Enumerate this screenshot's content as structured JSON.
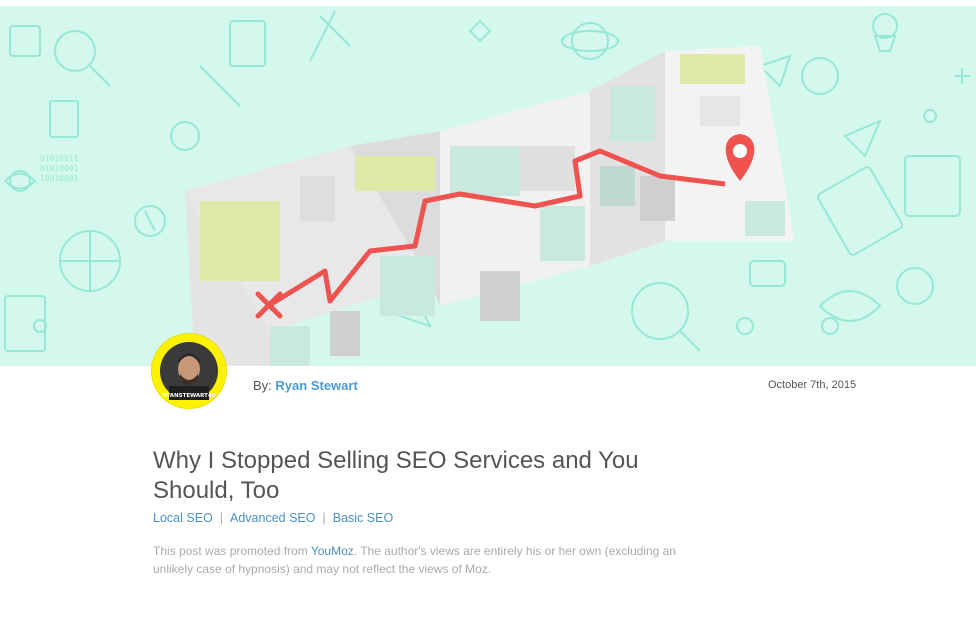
{
  "hero": {
    "icon": "map-route-illustration"
  },
  "author": {
    "avatar_caption": "RYANSTEWART40",
    "by_label": "By:",
    "name": "Ryan Stewart"
  },
  "post": {
    "date": "October 7th, 2015",
    "title": "Why I Stopped Selling SEO Services and You Should, Too",
    "categories": [
      "Local SEO",
      "Advanced SEO",
      "Basic SEO"
    ],
    "separator": "|",
    "promo_prefix": "This post was promoted from ",
    "promo_link": "YouMoz",
    "promo_suffix": ". The author's views are entirely his or her own (excluding an unlikely case of hypnosis) and may not reflect the views of Moz."
  },
  "colors": {
    "hero_bg": "#d5f8ee",
    "route": "#ef5350",
    "link": "#4a9bd6",
    "avatar_ring": "#fff200"
  }
}
